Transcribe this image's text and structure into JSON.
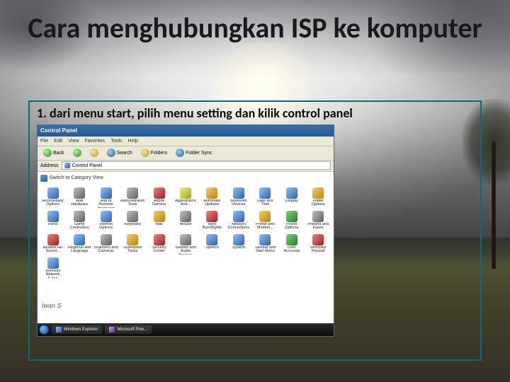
{
  "title": "Cara menghubungkan ISP ke komputer",
  "step": "1. dari menu start, pilih menu setting dan kilik control panel",
  "cp": {
    "window_title": "Control Panel",
    "menu": [
      "File",
      "Edit",
      "View",
      "Favorites",
      "Tools",
      "Help"
    ],
    "toolbar": {
      "back": "Back",
      "search": "Search",
      "folders": "Folders",
      "sync": "Folder Sync"
    },
    "address_label": "Address",
    "address_value": "Control Panel",
    "switch_view": "Switch to Category View",
    "watermark": "Iwan S",
    "taskbar": [
      "Windows Explorer",
      "Microsoft Pow..."
    ],
    "items": [
      {
        "label": "Accessibility Options",
        "c": "c2"
      },
      {
        "label": "Add Hardware",
        "c": "c3"
      },
      {
        "label": "Add or Remove Programs",
        "c": "c2"
      },
      {
        "label": "Administrative Tools",
        "c": "c3"
      },
      {
        "label": "Adobe Gamma",
        "c": "c4"
      },
      {
        "label": "Appearance And...",
        "c": "c7"
      },
      {
        "label": "Automatic Updates",
        "c": "c1"
      },
      {
        "label": "Bluetooth Devices",
        "c": "c2"
      },
      {
        "label": "Date and Time",
        "c": "c2"
      },
      {
        "label": "Display",
        "c": "c2"
      },
      {
        "label": "Folder Options",
        "c": "c1"
      },
      {
        "label": "Fonts",
        "c": "c2"
      },
      {
        "label": "Game Controllers",
        "c": "c3"
      },
      {
        "label": "Internet Options",
        "c": "c2"
      },
      {
        "label": "Keyboard",
        "c": "c3"
      },
      {
        "label": "Mail",
        "c": "c1"
      },
      {
        "label": "Mouse",
        "c": "c3"
      },
      {
        "label": "Nero BurnRights",
        "c": "c4"
      },
      {
        "label": "Network Connections",
        "c": "c2"
      },
      {
        "label": "Phone and Modem...",
        "c": "c1"
      },
      {
        "label": "Power Options",
        "c": "c5"
      },
      {
        "label": "Printers and Faxes",
        "c": "c3"
      },
      {
        "label": "Realtek HD Sound...",
        "c": "c4"
      },
      {
        "label": "Regional and Language",
        "c": "c2"
      },
      {
        "label": "Scanners and Cameras",
        "c": "c3"
      },
      {
        "label": "Scheduled Tasks",
        "c": "c1"
      },
      {
        "label": "Security Center",
        "c": "c4"
      },
      {
        "label": "Sounds and Audio Devices",
        "c": "c3"
      },
      {
        "label": "Speech",
        "c": "c2"
      },
      {
        "label": "System",
        "c": "c2"
      },
      {
        "label": "Taskbar and Start Menu",
        "c": "c2"
      },
      {
        "label": "User Accounts",
        "c": "c5"
      },
      {
        "label": "Windows Firewall",
        "c": "c4"
      },
      {
        "label": "Wireless Network Setup",
        "c": "c2"
      }
    ]
  }
}
